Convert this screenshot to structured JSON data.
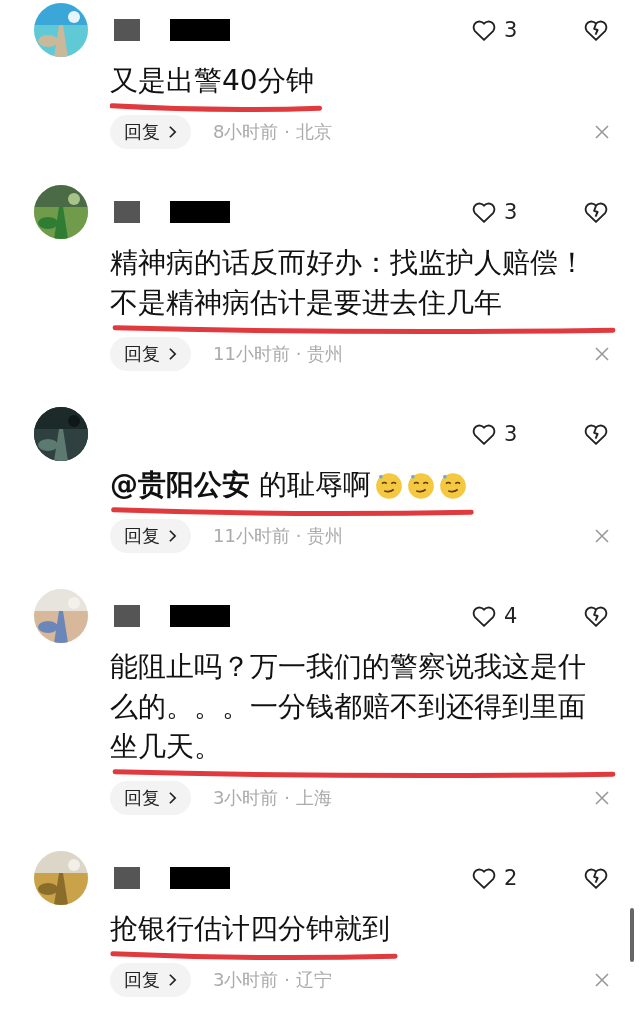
{
  "comments": [
    {
      "author": {
        "redacted": true
      },
      "text": "又是出警40分钟",
      "likes": "3",
      "time": "8小时前 · 北京",
      "reply": "回复",
      "underlined": true
    },
    {
      "author": {
        "redacted": true
      },
      "text": "精神病的话反而好办：找监护人赔偿！不是精神病估计是要进去住几年",
      "likes": "3",
      "time": "11小时前 · 贵州",
      "reply": "回复",
      "underlined": true
    },
    {
      "text": "**@贵阳公安** 的耻辱啊",
      "emojis": [
        {
          "kind": "smirk"
        },
        {
          "kind": "smirk"
        },
        {
          "kind": "smirk"
        }
      ],
      "likes": "3",
      "time": "11小时前 · 贵州",
      "reply": "回复",
      "underlined": true
    },
    {
      "author": {
        "redacted": true
      },
      "text": "能阻止吗？万一我们的警察说我这是什么的。。。一分钱都赔不到还得到里面坐几天。",
      "likes": "4",
      "time": "3小时前 · 上海",
      "reply": "回复",
      "underlined": true
    },
    {
      "author": {
        "redacted": true
      },
      "text": "抢银行估计四分钟就到",
      "likes": "2",
      "time": "3小时前 · 辽宁",
      "reply": "回复",
      "underlined": true
    }
  ]
}
